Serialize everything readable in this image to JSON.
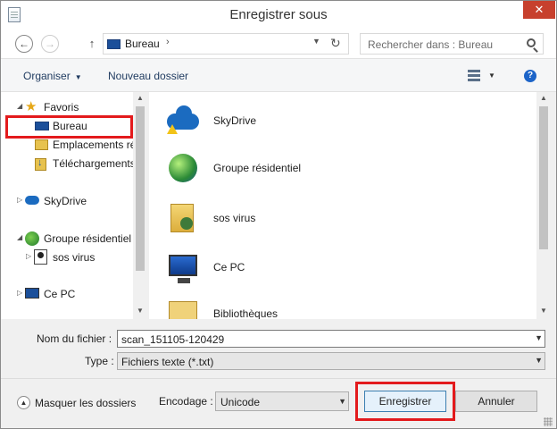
{
  "window": {
    "title": "Enregistrer sous",
    "close_label": "✕"
  },
  "nav": {
    "back_label": "←",
    "forward_label": "→",
    "up_label": "↑",
    "address": {
      "location": "Bureau",
      "chevron": "›"
    },
    "refresh_label": "↻",
    "search": {
      "placeholder": "Rechercher dans : Bureau"
    }
  },
  "toolbar": {
    "organize_label": "Organiser",
    "new_folder_label": "Nouveau dossier",
    "help_label": "?"
  },
  "tree": {
    "items": [
      {
        "label": "Favoris",
        "icon": "star-icon",
        "level": 0,
        "expanded": true
      },
      {
        "label": "Bureau",
        "icon": "desktop-icon",
        "level": 1,
        "selected": true
      },
      {
        "label": "Emplacements ré",
        "icon": "recent-places-icon",
        "level": 1
      },
      {
        "label": "Téléchargements",
        "icon": "downloads-icon",
        "level": 1
      },
      {
        "label": "SkyDrive",
        "icon": "cloud-icon",
        "level": 0,
        "expanded": false
      },
      {
        "label": "Groupe résidentiel",
        "icon": "homegroup-icon",
        "level": 0,
        "expanded": true
      },
      {
        "label": "sos virus",
        "icon": "user-icon",
        "level": 1
      },
      {
        "label": "Ce PC",
        "icon": "computer-icon",
        "level": 0,
        "expanded": false
      }
    ]
  },
  "content": {
    "items": [
      {
        "label": "SkyDrive",
        "icon": "skydrive-warning-icon"
      },
      {
        "label": "Groupe résidentiel",
        "icon": "homegroup-icon"
      },
      {
        "label": "sos virus",
        "icon": "user-folder-icon"
      },
      {
        "label": "Ce PC",
        "icon": "computer-icon"
      },
      {
        "label": "Bibliothèques",
        "icon": "libraries-icon"
      }
    ]
  },
  "form": {
    "filename_label": "Nom du fichier :",
    "filename_value": "scan_151105-120429",
    "type_label": "Type :",
    "type_value": "Fichiers texte (*.txt)",
    "hide_folders_label": "Masquer les dossiers",
    "encoding_label": "Encodage :",
    "encoding_value": "Unicode",
    "save_label": "Enregistrer",
    "cancel_label": "Annuler"
  },
  "colors": {
    "highlight": "#e31a1c",
    "accent": "#1c64c8",
    "close": "#c7402d"
  }
}
